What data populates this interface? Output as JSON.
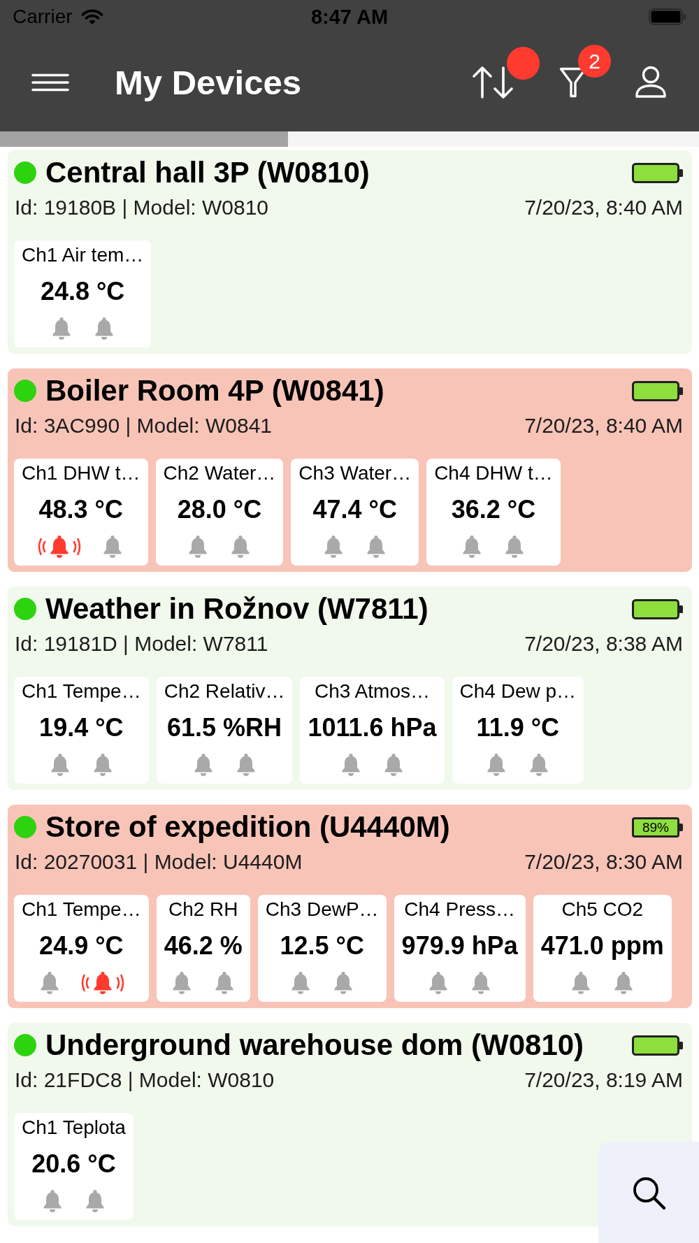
{
  "status_bar": {
    "carrier": "Carrier",
    "time": "8:47 AM"
  },
  "nav": {
    "title": "My Devices",
    "actions": [
      {
        "kind": "sort",
        "badge": true
      },
      {
        "kind": "filter",
        "badge": true,
        "count": "2"
      },
      {
        "kind": "account"
      }
    ]
  },
  "progress": {
    "level": 0.412
  },
  "devices": [
    {
      "name": "Central hall 3P (W0810)",
      "online": true,
      "alarm": false,
      "info": "Id: 19180B | Model: W0810",
      "time": "7/20/23, 8:40 AM",
      "channels": [
        {
          "label": "Ch1 Air tem…",
          "value": "24.8 °C",
          "bells": [
            {
              "ringing": false
            },
            {
              "ringing": false
            }
          ]
        }
      ]
    },
    {
      "name": "Boiler Room 4P (W0841)",
      "online": true,
      "alarm": true,
      "info": "Id: 3AC990 | Model: W0841",
      "time": "7/20/23, 8:40 AM",
      "channels": [
        {
          "label": "Ch1 DHW t…",
          "value": "48.3 °C",
          "bells": [
            {
              "ringing": true
            },
            {
              "ringing": false
            }
          ]
        },
        {
          "label": "Ch2 Water…",
          "value": "28.0 °C",
          "bells": [
            {
              "ringing": false
            },
            {
              "ringing": false
            }
          ]
        },
        {
          "label": "Ch3 Water…",
          "value": "47.4 °C",
          "bells": [
            {
              "ringing": false
            },
            {
              "ringing": false
            }
          ]
        },
        {
          "label": "Ch4 DHW t…",
          "value": "36.2 °C",
          "bells": [
            {
              "ringing": false
            },
            {
              "ringing": false
            }
          ]
        }
      ]
    },
    {
      "name": "Weather in Rožnov (W7811)",
      "online": true,
      "alarm": false,
      "info": "Id: 19181D | Model: W7811",
      "time": "7/20/23, 8:38 AM",
      "channels": [
        {
          "label": "Ch1 Tempe…",
          "value": "19.4 °C",
          "bells": [
            {
              "ringing": false
            },
            {
              "ringing": false
            }
          ]
        },
        {
          "label": "Ch2 Relativ…",
          "value": "61.5 %RH",
          "bells": [
            {
              "ringing": false
            },
            {
              "ringing": false
            }
          ]
        },
        {
          "label": "Ch3 Atmos…",
          "value": "1011.6 hPa",
          "bells": [
            {
              "ringing": false
            },
            {
              "ringing": false
            }
          ]
        },
        {
          "label": "Ch4 Dew p…",
          "value": "11.9 °C",
          "bells": [
            {
              "ringing": false
            },
            {
              "ringing": false
            }
          ]
        }
      ]
    },
    {
      "name": "Store of expedition (U4440M)",
      "online": true,
      "alarm": true,
      "battery": "89%",
      "info": "Id: 20270031 | Model: U4440M",
      "time": "7/20/23, 8:30 AM",
      "channels": [
        {
          "label": "Ch1 Tempe…",
          "value": "24.9 °C",
          "bells": [
            {
              "ringing": false
            },
            {
              "ringing": true
            }
          ]
        },
        {
          "label": "Ch2 RH",
          "value": "46.2 %",
          "bells": [
            {
              "ringing": false
            },
            {
              "ringing": false
            }
          ]
        },
        {
          "label": "Ch3 DewP…",
          "value": "12.5 °C",
          "bells": [
            {
              "ringing": false
            },
            {
              "ringing": false
            }
          ]
        },
        {
          "label": "Ch4 Press…",
          "value": "979.9 hPa",
          "bells": [
            {
              "ringing": false
            },
            {
              "ringing": false
            }
          ]
        },
        {
          "label": "Ch5 CO2",
          "value": "471.0 ppm",
          "bells": [
            {
              "ringing": false
            },
            {
              "ringing": false
            }
          ]
        }
      ]
    },
    {
      "name": "Underground warehouse dom (W0810)",
      "online": true,
      "alarm": false,
      "info": "Id: 21FDC8 | Model: W0810",
      "time": "7/20/23, 8:19 AM",
      "channels": [
        {
          "label": "Ch1 Teplota",
          "value": "20.6 °C",
          "bells": [
            {
              "ringing": false
            },
            {
              "ringing": false
            }
          ]
        }
      ]
    }
  ]
}
